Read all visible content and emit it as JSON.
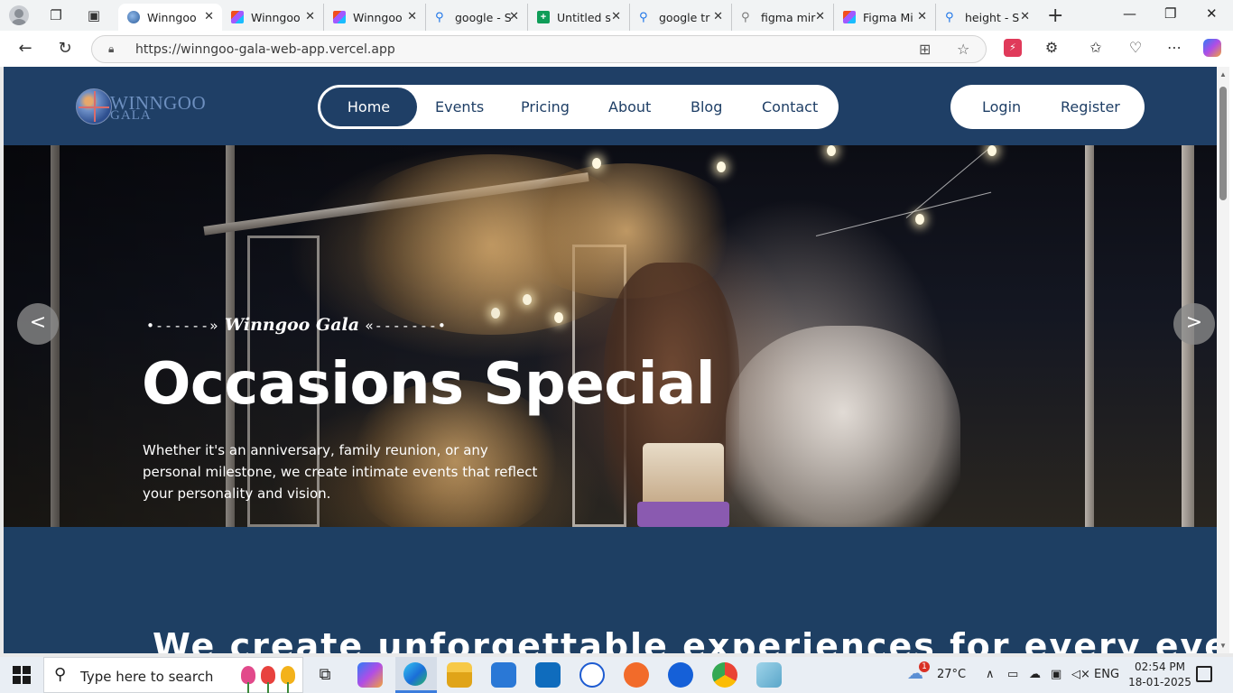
{
  "browser": {
    "tabs": [
      {
        "title": "Winngoo",
        "favicon": "globe-icon",
        "active": true
      },
      {
        "title": "Winngoo",
        "favicon": "figma-icon",
        "active": false
      },
      {
        "title": "Winngoo",
        "favicon": "figma-icon",
        "active": false
      },
      {
        "title": "google - S",
        "favicon": "search-icon",
        "active": false
      },
      {
        "title": "Untitled s",
        "favicon": "sheets-icon",
        "active": false
      },
      {
        "title": "google tr",
        "favicon": "search-icon",
        "active": false
      },
      {
        "title": "figma mir",
        "favicon": "search-icon",
        "active": false
      },
      {
        "title": "Figma Mi",
        "favicon": "figma-icon",
        "active": false
      },
      {
        "title": "height - S",
        "favicon": "search-icon",
        "active": false
      }
    ],
    "url": "https://winngoo-gala-web-app.vercel.app"
  },
  "site": {
    "logo": {
      "line1": "WINNGOO",
      "line2": "GALA"
    },
    "nav": [
      "Home",
      "Events",
      "Pricing",
      "About",
      "Blog",
      "Contact"
    ],
    "nav_active": "Home",
    "auth": {
      "login": "Login",
      "register": "Register"
    },
    "colors": {
      "primary": "#1f3f66",
      "white": "#ffffff"
    }
  },
  "hero": {
    "tagline_left": "•------»",
    "tagline": "Winngoo Gala",
    "tagline_right": "«-------•",
    "headline": "Occasions Special",
    "subtext": "Whether it's an anniversary, family reunion, or any personal milestone, we create intimate events that reflect your personality and vision.",
    "prev": "<",
    "next": ">"
  },
  "section2": {
    "title": "We create unforgettable experiences for every event"
  },
  "taskbar": {
    "search_placeholder": "Type here to search",
    "weather": "27°C",
    "language": "ENG",
    "time": "02:54 PM",
    "date": "18-01-2025",
    "weather_badge": "1"
  }
}
